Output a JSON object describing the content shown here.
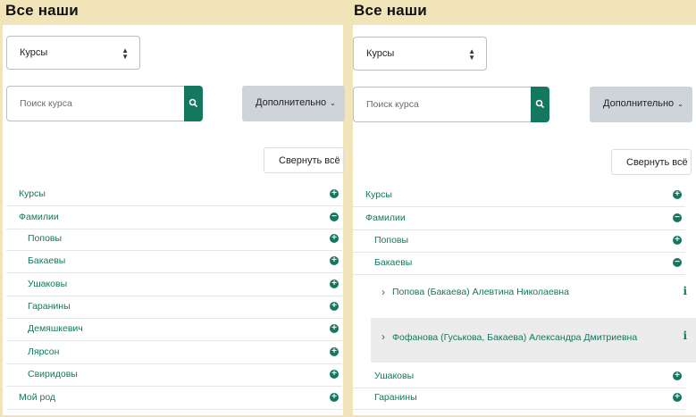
{
  "left": {
    "title": "Все наши",
    "select_value": "Курсы",
    "search_placeholder": "Поиск курса",
    "more_label": "Дополнительно",
    "collapse_label": "Свернуть всё",
    "tree": [
      {
        "label": "Курсы",
        "level": 0,
        "state": "plus"
      },
      {
        "label": "Фамилии",
        "level": 0,
        "state": "minus"
      },
      {
        "label": "Поповы",
        "level": 1,
        "state": "plus"
      },
      {
        "label": "Бакаевы",
        "level": 1,
        "state": "plus"
      },
      {
        "label": "Ушаковы",
        "level": 1,
        "state": "plus"
      },
      {
        "label": "Гаранины",
        "level": 1,
        "state": "plus"
      },
      {
        "label": "Демяшкевич",
        "level": 1,
        "state": "plus"
      },
      {
        "label": "Лярсон",
        "level": 1,
        "state": "plus"
      },
      {
        "label": "Свиридовы",
        "level": 1,
        "state": "plus"
      },
      {
        "label": "Мой род",
        "level": 0,
        "state": "plus"
      }
    ]
  },
  "right": {
    "title": "Все наши",
    "select_value": "Курсы",
    "search_placeholder": "Поиск курса",
    "more_label": "Дополнительно",
    "collapse_label": "Свернуть всё",
    "tree_top": [
      {
        "label": "Курсы",
        "level": 0,
        "state": "plus"
      },
      {
        "label": "Фамилии",
        "level": 0,
        "state": "minus"
      },
      {
        "label": "Поповы",
        "level": 1,
        "state": "plus"
      },
      {
        "label": "Бакаевы",
        "level": 1,
        "state": "minus"
      }
    ],
    "courses": [
      {
        "label": "Попова (Бакаева) Алевтина Николаевна"
      },
      {
        "label": "Фофанова (Гуськова, Бакаева) Александра Дмитриевна"
      }
    ],
    "tree_bottom": [
      {
        "label": "Ушаковы",
        "level": 1,
        "state": "plus"
      },
      {
        "label": "Гаранины",
        "level": 1,
        "state": "plus"
      }
    ]
  },
  "icons": {
    "plus": "⊕",
    "minus": "⊖",
    "search": "search-icon",
    "chevron_right": "›",
    "info": "i"
  },
  "colors": {
    "accent": "#14775f",
    "panel_bg": "#f1e4b8",
    "button_grey": "#ced4da"
  }
}
